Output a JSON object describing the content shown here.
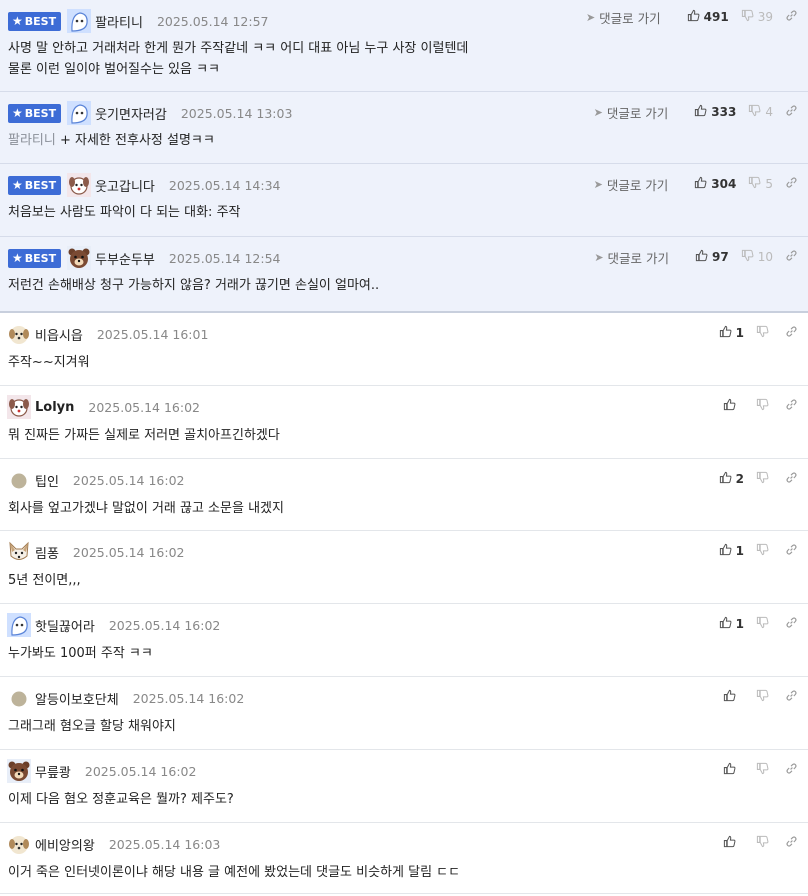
{
  "best_badge_label": "BEST",
  "reply_label": "댓글로 가기",
  "best_comments": [
    {
      "avatar_icon": "ghost-face-icon",
      "nickname": "팔라티니",
      "time": "2025.05.14 12:57",
      "lines": [
        "사명 말 안하고 거래처라 한게 뭔가 주작같네 ㅋㅋ 어디 대표 아님 누구 사장 이럴텐데",
        "물론 이런 일이야 벌어질수는 있음 ㅋㅋ"
      ],
      "mention": "",
      "likes": "491",
      "dislikes": "39"
    },
    {
      "avatar_icon": "ghost-face-icon",
      "nickname": "웃기면자러감",
      "time": "2025.05.14 13:03",
      "lines": [
        "+ 자세한 전후사정 설명ㅋㅋ"
      ],
      "mention": "팔라티니",
      "likes": "333",
      "dislikes": "4"
    },
    {
      "avatar_icon": "dog-face-icon",
      "nickname": "웃고갑니다",
      "time": "2025.05.14 14:34",
      "lines": [
        "처음보는 사람도 파악이 다 되는 대화: 주작"
      ],
      "mention": "",
      "likes": "304",
      "dislikes": "5"
    },
    {
      "avatar_icon": "bear-face-icon",
      "nickname": "두부순두부",
      "time": "2025.05.14 12:54",
      "lines": [
        "저런건 손해배상 청구 가능하지 않음? 거래가 끊기면 손실이 얼마여.."
      ],
      "mention": "",
      "likes": "97",
      "dislikes": "10"
    }
  ],
  "comments": [
    {
      "avatar_icon": "puppy-face-icon",
      "nickname": "비읍시읍",
      "time": "2025.05.14 16:01",
      "text": "주작~~지겨워",
      "likes": "1"
    },
    {
      "avatar_icon": "dog-face-icon",
      "nickname": "Lolyn",
      "time": "2025.05.14 16:02",
      "text": "뭐 진짜든 가짜든 실제로 저러면 골치아프긴하겠다",
      "likes": ""
    },
    {
      "avatar_icon": "dot-avatar-icon",
      "nickname": "팁인",
      "time": "2025.05.14 16:02",
      "text": "회사를 엎고가겠냐 말없이 거래 끊고 소문을 내겠지",
      "likes": "2"
    },
    {
      "avatar_icon": "fox-face-icon",
      "nickname": "림퐁",
      "time": "2025.05.14 16:02",
      "text": "5년 전이면,,,",
      "likes": "1"
    },
    {
      "avatar_icon": "ghost-face-icon",
      "nickname": "핫딜끊어라",
      "time": "2025.05.14 16:02",
      "text": "누가봐도 100퍼 주작 ㅋㅋ",
      "likes": "1"
    },
    {
      "avatar_icon": "dot-avatar-icon",
      "nickname": "알등이보호단체",
      "time": "2025.05.14 16:02",
      "text": "그래그래 혐오글 할당 채워야지",
      "likes": ""
    },
    {
      "avatar_icon": "bear-face-icon",
      "nickname": "무릎쾅",
      "time": "2025.05.14 16:02",
      "text": "이제 다음 혐오 정훈교육은 뭘까? 제주도?",
      "likes": ""
    },
    {
      "avatar_icon": "puppy-face-icon",
      "nickname": "에비앙의왕",
      "time": "2025.05.14 16:03",
      "text": "이거 죽은 인터넷이론이냐 해당 내용 글 예전에 봤었는데 댓글도 비슷하게 달림 ㄷㄷ",
      "likes": ""
    }
  ],
  "colors": {
    "best_bg": "#eef2fb",
    "badge": "#3d6cd6"
  }
}
